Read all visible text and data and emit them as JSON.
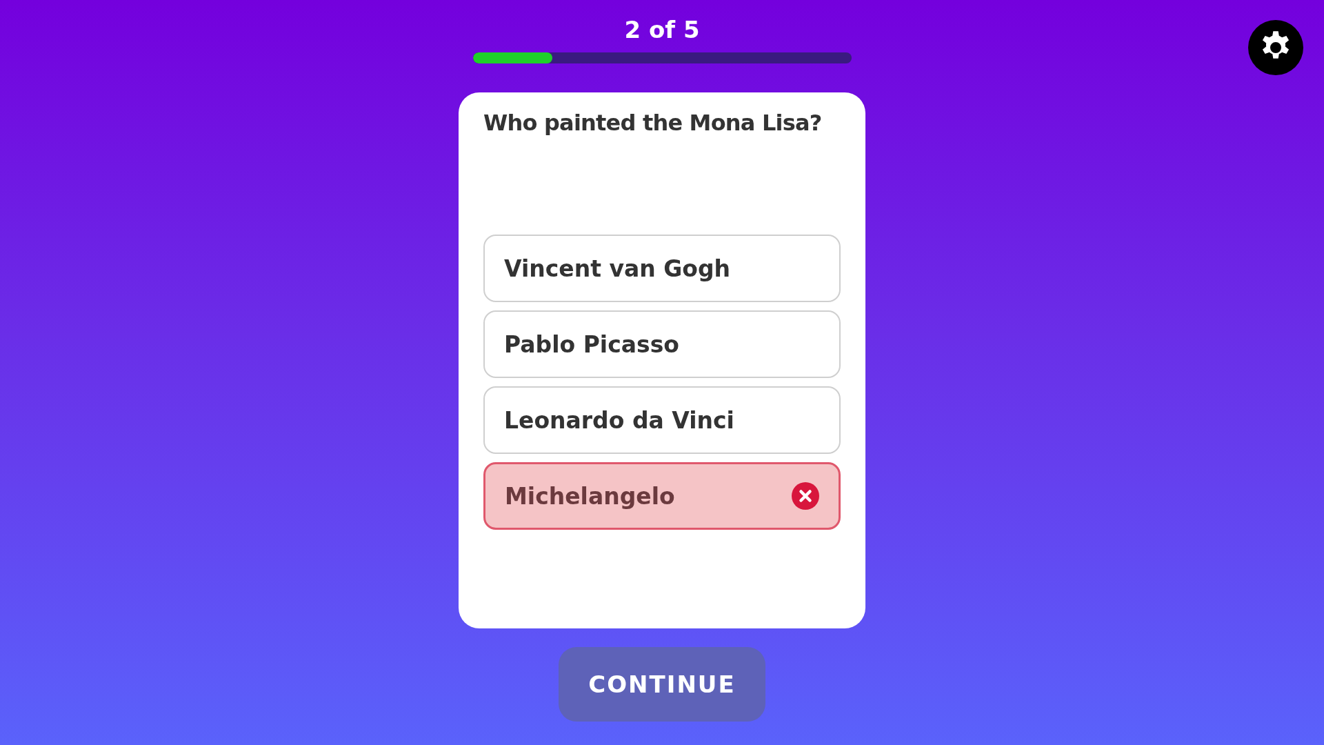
{
  "progress": {
    "label": "2 of 5",
    "level": 0.21
  },
  "question": "Who painted the Mona Lisa?",
  "options": [
    {
      "label": "Vincent van Gogh",
      "selected": false,
      "incorrect": false
    },
    {
      "label": "Pablo Picasso",
      "selected": false,
      "incorrect": false
    },
    {
      "label": "Leonardo da Vinci",
      "selected": false,
      "incorrect": false
    },
    {
      "label": "Michelangelo",
      "selected": true,
      "incorrect": true
    }
  ],
  "continue_button": {
    "label": "CONTINUE"
  }
}
